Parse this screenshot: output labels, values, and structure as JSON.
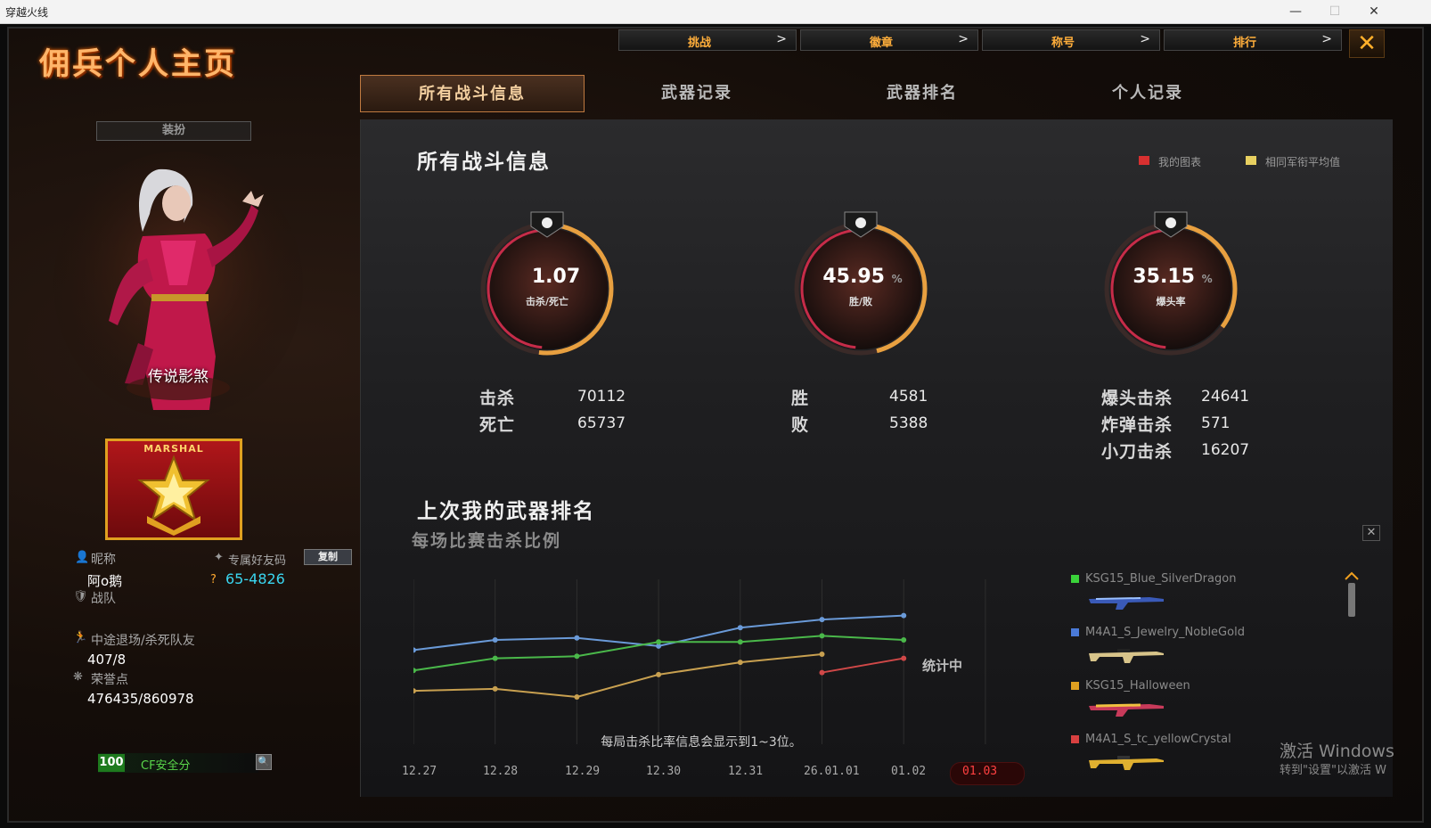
{
  "window": {
    "title": "穿越火线",
    "min": "—",
    "max": "☐",
    "close": "✕"
  },
  "header": {
    "title": "佣兵个人主页"
  },
  "topnav": [
    {
      "label": "挑战",
      "arrow": ">"
    },
    {
      "label": "徽章",
      "arrow": ">"
    },
    {
      "label": "称号",
      "arrow": ">"
    },
    {
      "label": "排行",
      "arrow": ">"
    }
  ],
  "close_label": "✕",
  "tabs": [
    {
      "label": "所有战斗信息",
      "active": true
    },
    {
      "label": "武器记录",
      "active": false
    },
    {
      "label": "武器排名",
      "active": false
    },
    {
      "label": "个人记录",
      "active": false
    }
  ],
  "left": {
    "dress_button": "装扮",
    "character_name": "传说影煞",
    "rank_title": "MARSHAL",
    "nickname_label": "昵称",
    "nickname": "阿o鹅",
    "friend_code_label": "专属好友码",
    "copy_button": "复制",
    "friend_code": "65-4826",
    "clan_label": "战队",
    "quit_label": "中途退场/杀死队友",
    "quit_value": "407/8",
    "honor_label": "荣誉点",
    "honor_value": "476435/860978",
    "safety_score": "100",
    "safety_label": "CF安全分"
  },
  "panel": {
    "title": "所有战斗信息",
    "legend": [
      {
        "label": "我的图表",
        "color": "#d83030"
      },
      {
        "label": "相同军衔平均值",
        "color": "#e8d060"
      }
    ],
    "gauges": [
      {
        "value": "1.07",
        "unit": "",
        "label": "击杀/死亡",
        "fraction": 0.52,
        "icon": "skull-icon"
      },
      {
        "value": "45.95",
        "unit": "%",
        "label": "胜/败",
        "fraction": 0.4595,
        "icon": "crossed-swords-icon"
      },
      {
        "value": "35.15",
        "unit": "%",
        "label": "爆头率",
        "fraction": 0.3515,
        "icon": "headshot-icon"
      }
    ],
    "stats": [
      [
        {
          "k": "击杀",
          "v": "70112"
        },
        {
          "k": "死亡",
          "v": "65737"
        }
      ],
      [
        {
          "k": "胜",
          "v": "4581"
        },
        {
          "k": "败",
          "v": "5388"
        }
      ],
      [
        {
          "k": "爆头击杀",
          "v": "24641"
        },
        {
          "k": "炸弹击杀",
          "v": "571"
        },
        {
          "k": "小刀击杀",
          "v": "16207"
        }
      ]
    ],
    "section2_title": "上次我的武器排名",
    "section2_subtitle": "每场比赛击杀比例",
    "counting_label": "统计中",
    "chart_note": "每局击杀比率信息会显示到1~3位。",
    "weapons": [
      {
        "name": "KSG15_Blue_SilverDragon",
        "color": "#3ad23a"
      },
      {
        "name": "M4A1_S_Jewelry_NobleGold",
        "color": "#4a7ad8"
      },
      {
        "name": "KSG15_Halloween",
        "color": "#e0a020"
      },
      {
        "name": "M4A1_S_tc_yellowCrystal",
        "color": "#d84040"
      }
    ],
    "watermark_line1": "激活 Windows",
    "watermark_line2": "转到\"设置\"以激活 W"
  },
  "chart_data": {
    "type": "line",
    "categories": [
      "12.27",
      "12.28",
      "12.29",
      "12.30",
      "12.31",
      "26.01.01",
      "01.02",
      "01.03"
    ],
    "active_category": "01.03",
    "series": [
      {
        "color": "#6a9ad8",
        "values": [
          0.74,
          0.79,
          0.8,
          0.76,
          0.85,
          0.89,
          0.91,
          null
        ]
      },
      {
        "color": "#4ab84a",
        "values": [
          0.64,
          0.7,
          0.71,
          0.78,
          0.78,
          0.81,
          0.79,
          null
        ]
      },
      {
        "color": "#c8a050",
        "values": [
          0.54,
          0.55,
          0.51,
          0.62,
          0.68,
          0.72,
          null,
          null
        ]
      },
      {
        "color": "#d04848",
        "values": [
          null,
          null,
          null,
          null,
          null,
          0.63,
          0.7,
          null
        ]
      }
    ],
    "ylim": [
      0.3,
      1.0
    ],
    "grid": false
  }
}
